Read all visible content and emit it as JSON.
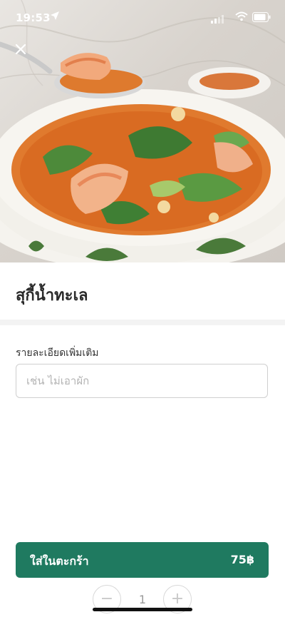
{
  "status_bar": {
    "time": "19:53",
    "location_icon": "location-arrow-icon",
    "signal_icon": "cellular-signal-icon",
    "wifi_icon": "wifi-icon",
    "battery_icon": "battery-icon"
  },
  "header": {
    "close_icon": "close-icon"
  },
  "dish": {
    "title": "สุกี้น้ำทะเล"
  },
  "details": {
    "label": "รายละเอียดเพิ่มเติม",
    "placeholder": "เช่น ไม่เอาผัก",
    "value": ""
  },
  "cart": {
    "label": "ใส่ในตะกร้า",
    "price": "75฿"
  },
  "quantity": {
    "value": "1",
    "minus_icon": "minus-icon",
    "plus_icon": "plus-icon"
  },
  "colors": {
    "accent": "#1f7a60",
    "input_border": "#cfcfcf",
    "divider": "#f3f3f3"
  }
}
